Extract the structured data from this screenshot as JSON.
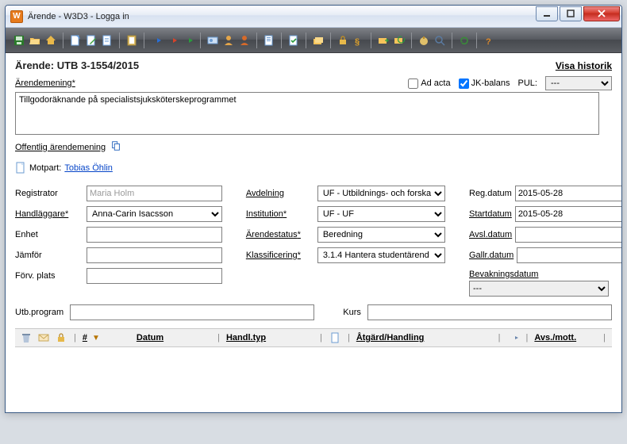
{
  "titlebar": {
    "app_icon_letter": "W",
    "title": "Ärende - W3D3 - Logga in"
  },
  "header": {
    "arende": "Ärende: UTB 3-1554/2015",
    "visa_historik": "Visa historik"
  },
  "section_desc": {
    "label": "Ärendemening",
    "ad_acta_label": "Ad acta",
    "ad_acta_checked": false,
    "jk_label": "JK-balans",
    "jk_checked": true,
    "pul_label": "PUL:",
    "pul_value": "---",
    "text": "Tillgodoräknande på specialistsjuksköterskeprogrammet",
    "offentlig": "Offentlig ärendemening"
  },
  "motpart": {
    "label": "Motpart:",
    "name": "Tobias Öhlin"
  },
  "col1": {
    "registrator_label": "Registrator",
    "registrator_value": "Maria Holm",
    "handlaggare_label": "Handläggare",
    "handlaggare_value": "Anna-Carin Isacsson",
    "enhet_label": "Enhet",
    "enhet_value": "",
    "jamfor_label": "Jämför",
    "jamfor_value": "",
    "forv_label": "Förv. plats",
    "forv_value": ""
  },
  "col2": {
    "avdelning_label": "Avdelning",
    "avdelning_value": "UF - Utbildnings- och forska",
    "institution_label": "Institution",
    "institution_value": "UF - UF",
    "arendestatus_label": "Ärendestatus",
    "arendestatus_value": "Beredning",
    "klass_label": "Klassificering",
    "klass_value": "3.1.4 Hantera studentärend"
  },
  "col3": {
    "regdatum_label": "Reg.datum",
    "regdatum_value": "2015-05-28",
    "startdatum_label": "Startdatum",
    "startdatum_value": "2015-05-28",
    "avsldatum_label": "Avsl.datum",
    "avsldatum_value": "",
    "gallrdatum_label": "Gallr.datum",
    "gallrdatum_value": "",
    "bevak_label": "Bevakningsdatum",
    "bevak_value": "---"
  },
  "row2": {
    "utb_label": "Utb.program",
    "utb_value": "",
    "kurs_label": "Kurs",
    "kurs_value": ""
  },
  "tablehead": {
    "hash": "#",
    "datum": "Datum",
    "handltyp": "Handl.typ",
    "atgard": "Åtgärd/Handling",
    "avsmott": "Avs./mott."
  }
}
